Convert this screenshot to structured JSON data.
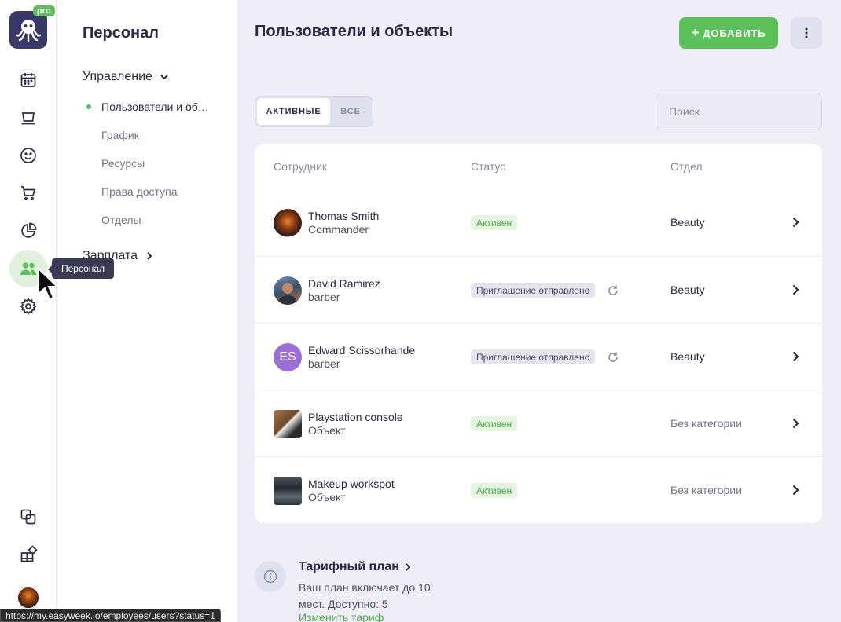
{
  "app": {
    "logo_badge": "pro"
  },
  "rail": {
    "items": [
      {
        "id": "calendar",
        "icon": "calendar-icon"
      },
      {
        "id": "services",
        "icon": "service-icon"
      },
      {
        "id": "clients",
        "icon": "smiley-icon"
      },
      {
        "id": "shop",
        "icon": "cart-icon"
      },
      {
        "id": "analytics",
        "icon": "pie-chart-icon"
      },
      {
        "id": "staff",
        "icon": "people-icon",
        "active": true
      },
      {
        "id": "settings",
        "icon": "gear-icon"
      },
      {
        "id": "copy",
        "icon": "copy-icon"
      },
      {
        "id": "apps",
        "icon": "apps-icon"
      }
    ],
    "tooltip": "Персонал"
  },
  "subnav": {
    "title": "Персонал",
    "groups": [
      {
        "label": "Управление",
        "expanded": true,
        "items": [
          {
            "label": "Пользователи и об…",
            "active": true
          },
          {
            "label": "График"
          },
          {
            "label": "Ресурсы"
          },
          {
            "label": "Права доступа"
          },
          {
            "label": "Отделы"
          }
        ]
      },
      {
        "label": "Зарплата",
        "expanded": false
      }
    ]
  },
  "main": {
    "title": "Пользователи и объекты",
    "add_label": "ДОБАВИТЬ",
    "add_plus": "+",
    "tabs": [
      {
        "label": "АКТИВНЫЕ",
        "active": true
      },
      {
        "label": "ВСЕ"
      }
    ],
    "search": {
      "placeholder": "Поиск",
      "value": ""
    },
    "table": {
      "headers": {
        "employee": "Сотрудник",
        "status": "Статус",
        "department": "Отдел"
      },
      "rows": [
        {
          "name": "Thomas Smith",
          "role": "Commander",
          "status": "Активен",
          "status_type": "active",
          "department": "Beauty",
          "avatar": "photo"
        },
        {
          "name": "David Ramirez",
          "role": "barber",
          "status": "Приглашение отправлено",
          "status_type": "invited",
          "department": "Beauty",
          "avatar": "photo"
        },
        {
          "name": "Edward Scissorhande",
          "role": "barber",
          "status": "Приглашение отправлено",
          "status_type": "invited",
          "department": "Beauty",
          "avatar": "initials",
          "initials": "ES"
        },
        {
          "name": "Playstation console",
          "role": "Объект",
          "status": "Активен",
          "status_type": "active",
          "department": "Без категории",
          "avatar": "photo-square"
        },
        {
          "name": "Makeup workspot",
          "role": "Объект",
          "status": "Активен",
          "status_type": "active",
          "department": "Без категории",
          "avatar": "photo-square"
        }
      ]
    },
    "plan": {
      "title": "Тарифный план",
      "text": "Ваш план включает до 10 мест. Доступно: 5",
      "link": "Изменить тариф"
    }
  },
  "statusbar": {
    "url": "https://my.easyweek.io/employees/users?status=1"
  },
  "colors": {
    "accent": "#5cc05a",
    "dark": "#2b2945",
    "bg": "#efeef8"
  }
}
